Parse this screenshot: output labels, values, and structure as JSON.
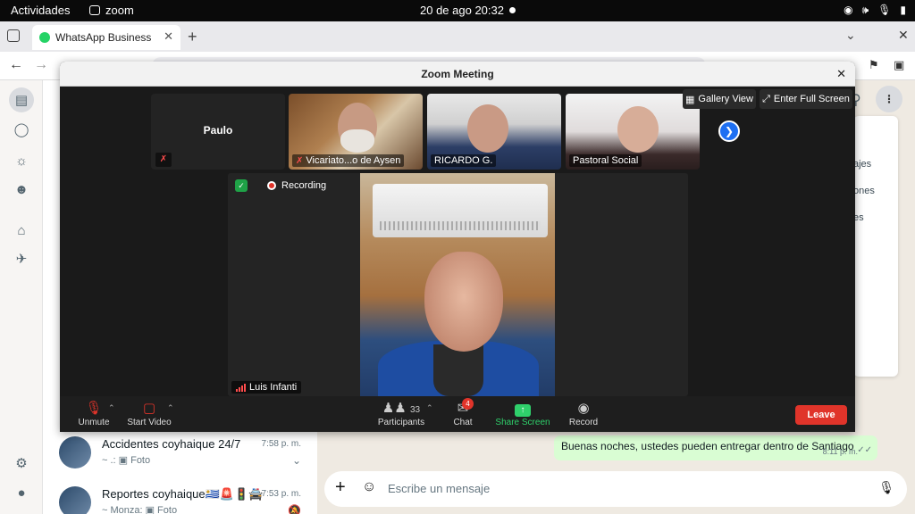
{
  "topbar": {
    "activities": "Actividades",
    "app_name": "zoom",
    "datetime": "20 de ago  20:32"
  },
  "browser": {
    "tab_title": "WhatsApp Business"
  },
  "whatsapp": {
    "chats": [
      {
        "name": "Accidentes coyhaique 24/7",
        "time": "7:58 p. m.",
        "preview": "~ .: ▣ Foto"
      },
      {
        "name": "Reportes coyhaique🇺🇾🚨🚦🚔",
        "time": "7:53 p. m.",
        "preview": "~ Monza: ▣ Foto"
      }
    ],
    "menu_partial": [
      "ajes",
      "ones",
      "es"
    ],
    "message": {
      "text": "Buenas noches, ustedes pueden entregar dentro de Santiago",
      "time": "8:11 p. m."
    },
    "composer_placeholder": "Escribe un mensaje"
  },
  "zoom": {
    "window_title": "Zoom Meeting",
    "gallery_view": "Gallery View",
    "full_screen": "Enter Full Screen",
    "recording": "Recording",
    "participants_tiles": [
      {
        "name": "Paulo"
      },
      {
        "name": "Vicariato...o de Aysen"
      },
      {
        "name": "RICARDO G."
      },
      {
        "name": "Pastoral Social"
      }
    ],
    "active_speaker": "Luis Infanti",
    "toolbar": {
      "unmute": "Unmute",
      "start_video": "Start Video",
      "participants": "Participants",
      "participants_count": "33",
      "chat": "Chat",
      "chat_badge": "4",
      "share_screen": "Share Screen",
      "record": "Record",
      "leave": "Leave"
    }
  }
}
